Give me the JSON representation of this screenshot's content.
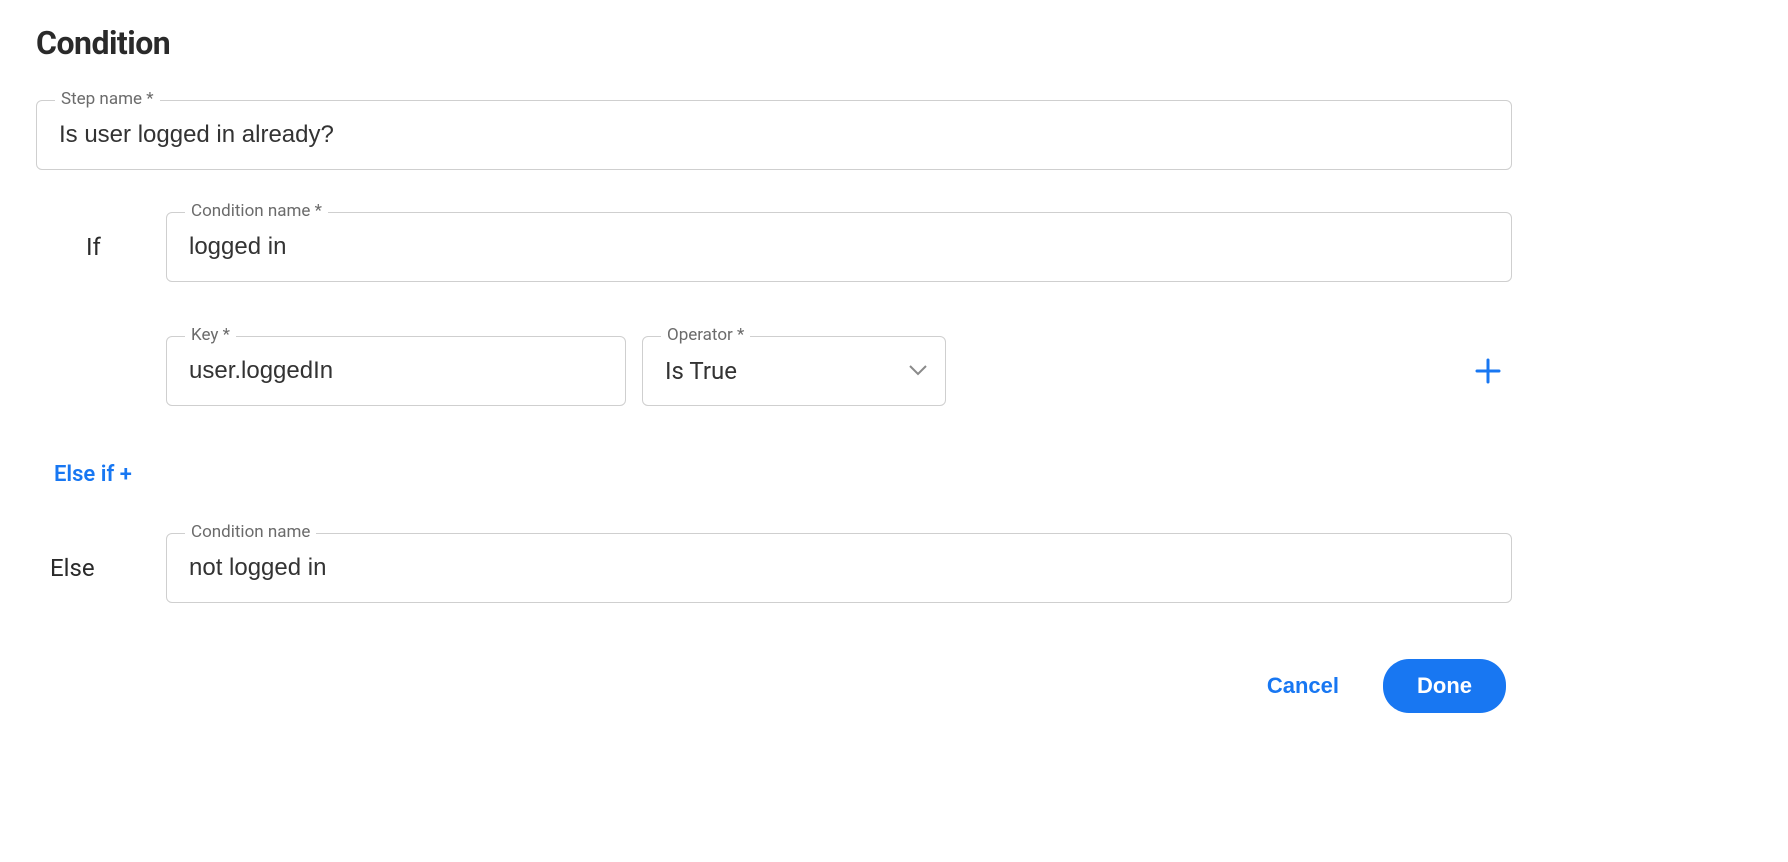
{
  "title": "Condition",
  "step_name": {
    "label": "Step name *",
    "value": "Is user logged in already?"
  },
  "if_branch": {
    "label": "If",
    "condition_name": {
      "label": "Condition name *",
      "value": "logged in"
    },
    "key": {
      "label": "Key *",
      "value": "user.loggedIn"
    },
    "operator": {
      "label": "Operator *",
      "value": "Is True"
    }
  },
  "else_if": {
    "label": "Else if +"
  },
  "else_branch": {
    "label": "Else",
    "condition_name": {
      "label": "Condition name",
      "value": "not logged in"
    }
  },
  "footer": {
    "cancel": "Cancel",
    "done": "Done"
  }
}
